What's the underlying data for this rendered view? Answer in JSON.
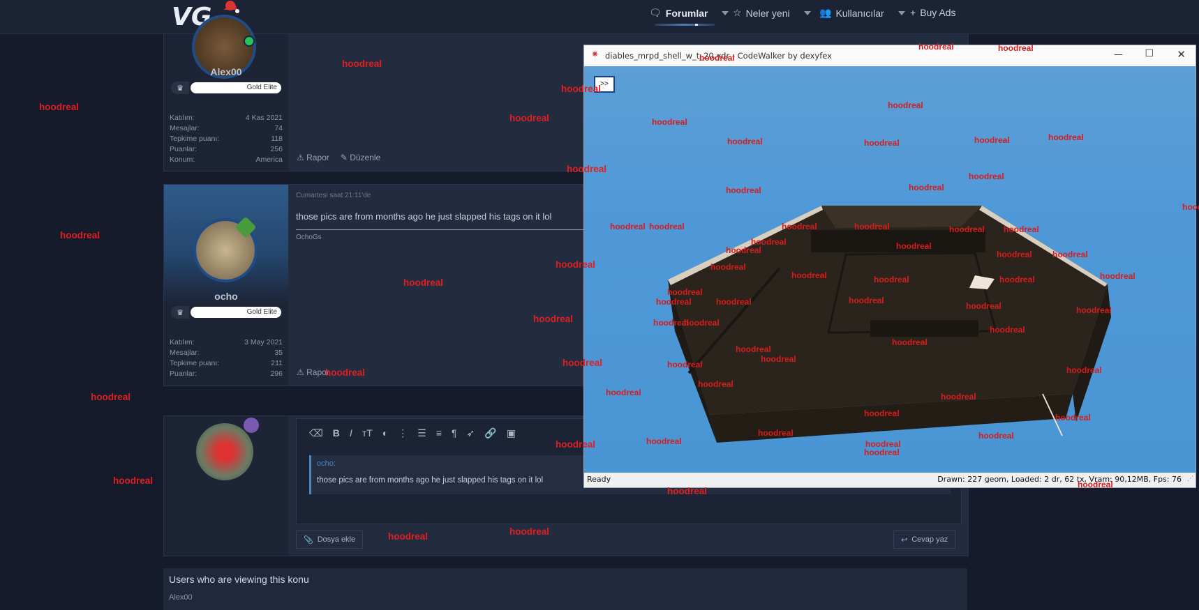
{
  "nav": {
    "forums": "Forumlar",
    "whats_new": "Neler yeni",
    "members": "Kullanıcılar",
    "buy_ads": "Buy Ads"
  },
  "post1": {
    "username": "Alex00",
    "rank": "Gold Elite",
    "stats": [
      {
        "label": "Katılım:",
        "value": "4 Kas 2021"
      },
      {
        "label": "Mesajlar:",
        "value": "74"
      },
      {
        "label": "Tepkime puanı:",
        "value": "118"
      },
      {
        "label": "Puanlar:",
        "value": "256"
      },
      {
        "label": "Konum:",
        "value": "America"
      }
    ],
    "report": "Rapor",
    "edit": "Düzenle"
  },
  "post2": {
    "username": "ocho",
    "rank": "Gold Elite",
    "date": "Cumartesi saat 21:11'de",
    "text": "those pics are from months ago he just slapped his tags on it lol",
    "signature": "OchoGs",
    "stats": [
      {
        "label": "Katılım:",
        "value": "3 May 2021"
      },
      {
        "label": "Mesajlar:",
        "value": "35"
      },
      {
        "label": "Tepkime puanı:",
        "value": "211"
      },
      {
        "label": "Puanlar:",
        "value": "296"
      }
    ],
    "report": "Rapor"
  },
  "editor": {
    "quote_author": "ocho:",
    "quote_text": "those pics are from months ago he just slapped his tags on it lol",
    "attach": "Dosya ekle",
    "reply": "Cevap yaz"
  },
  "viewing": {
    "title": "Users who are viewing this konu",
    "users": "Alex00"
  },
  "codewalker": {
    "title": "diables_mrpd_shell_w_t_20.ydr - CodeWalker by dexyfex",
    "toggle": ">>",
    "status_left": "Ready",
    "status_right": "Drawn: 227 geom, Loaded: 2 dr, 62 tx, Vram: 90,12MB, Fps: 76"
  },
  "overlay_word": "hoodreal",
  "colors": {
    "page_bg": "#151b2a",
    "panel": "#20283b",
    "accent": "#4a87c3",
    "overlay_red": "#e02020",
    "sky": "#4e98d8"
  }
}
